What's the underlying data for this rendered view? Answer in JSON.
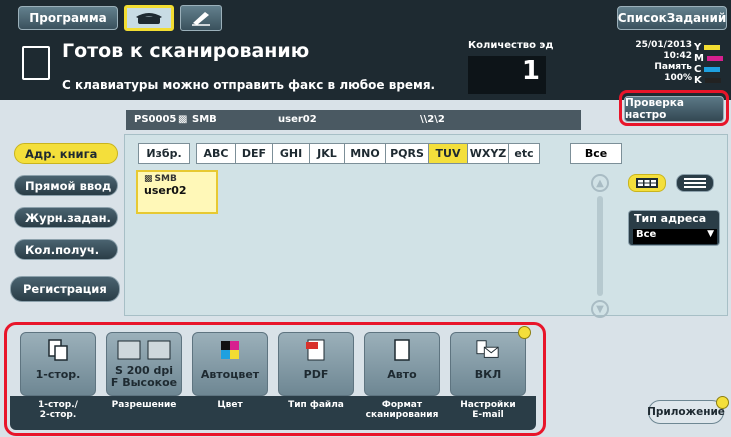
{
  "topbar": {
    "program_label": "Программа",
    "jobs_label": "СписокЗаданий"
  },
  "status": {
    "title": "Готов к сканированию",
    "subtitle": "С клавиатуры можно отправить факс в любое время.",
    "count_label": "Количество эд",
    "count_value": "1",
    "date": "25/01/2013",
    "time": "10:42",
    "memory_label": "Память",
    "memory_value": "100%",
    "toner": [
      {
        "letter": "Y",
        "color": "#f2dd32"
      },
      {
        "letter": "M",
        "color": "#d6208f"
      },
      {
        "letter": "C",
        "color": "#1ea0e0"
      },
      {
        "letter": "K",
        "color": "#222222"
      }
    ]
  },
  "path": {
    "address_id": "PS0005",
    "protocol": "SMB",
    "user": "user02",
    "folder": "\\\\2\\2"
  },
  "check_settings_label": "Проверка настро",
  "leftmenu": {
    "items": [
      "Адр. книга",
      "Прямой ввод",
      "Журн.задан.",
      "Кол.получ."
    ],
    "register_label": "Регистрация"
  },
  "letters": [
    "Избр.",
    "ABC",
    "DEF",
    "GHI",
    "JKL",
    "MNO",
    "PQRS",
    "TUV",
    "WXYZ",
    "etc"
  ],
  "all_label": "Все",
  "address_entry": {
    "type": "SMB",
    "name": "user02"
  },
  "address_type": {
    "label": "Тип адреса",
    "value": "Все"
  },
  "tiles": [
    {
      "value": "1-стор.",
      "caption": "1-стор./\n2-стор."
    },
    {
      "value": "S 200 dpi\nF Высокое",
      "caption": "Разрешение"
    },
    {
      "value": "Автоцвет",
      "caption": "Цвет"
    },
    {
      "value": "PDF",
      "caption": "Тип файла"
    },
    {
      "value": "Авто",
      "caption": "Формат\nсканирования"
    },
    {
      "value": "ВКЛ",
      "caption": "Настройки\nE-mail"
    }
  ],
  "app_label": "Приложение"
}
